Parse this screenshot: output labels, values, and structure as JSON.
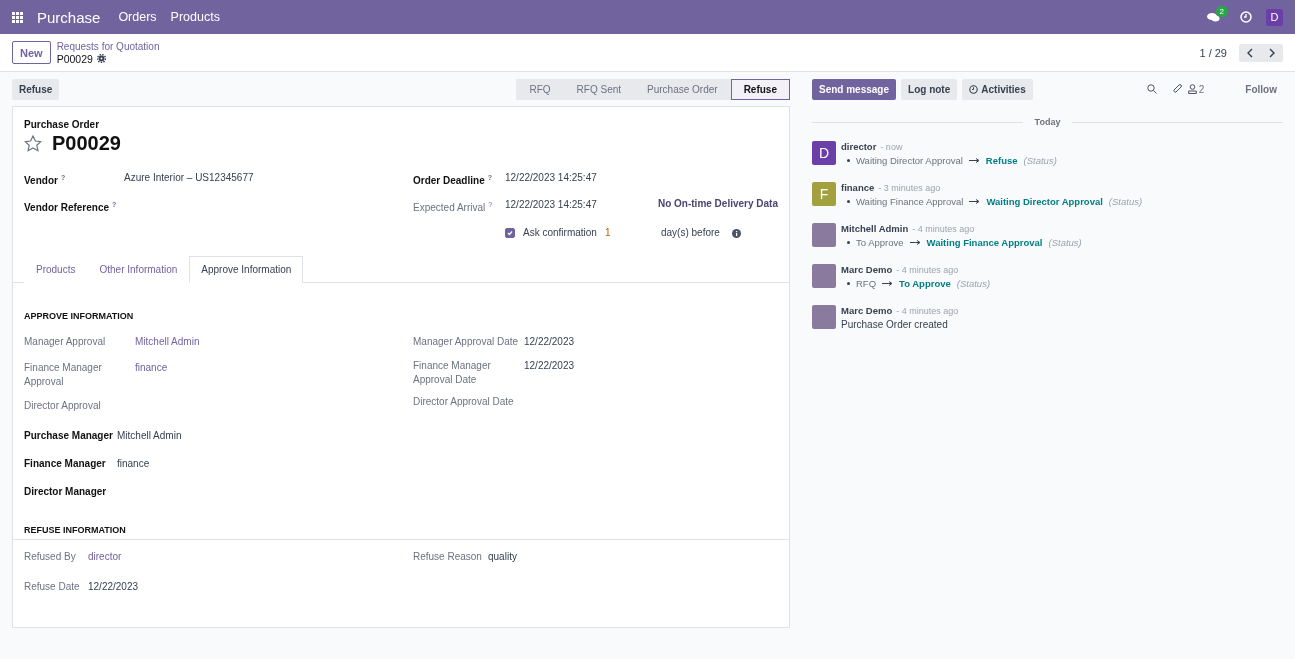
{
  "navbar": {
    "app_name": "Purchase",
    "menu": [
      {
        "label": "Orders"
      },
      {
        "label": "Products"
      }
    ],
    "messages_count": "2",
    "user_initial": "D"
  },
  "breadcrumb": {
    "new_button": "New",
    "parent": "Requests for Quotation",
    "current": "P00029",
    "pager": "1 / 29"
  },
  "action_buttons": [
    "Refuse"
  ],
  "statusbar": [
    {
      "label": "RFQ",
      "selected": false
    },
    {
      "label": "RFQ Sent",
      "selected": false
    },
    {
      "label": "Purchase Order",
      "selected": false
    },
    {
      "label": "Refuse",
      "selected": true
    }
  ],
  "form": {
    "title_label": "Purchase Order",
    "name": "P00029",
    "starred": false,
    "fields_left": [
      {
        "label": "Vendor",
        "help": "?",
        "kind": "strong",
        "value": "Azure Interior – US12345677"
      },
      {
        "label": "Vendor Reference",
        "help": "?",
        "kind": "strong"
      }
    ],
    "fields_right": [
      {
        "label": "Order Deadline",
        "help": "?",
        "kind": "strong",
        "value": "12/22/2023 14:25:47"
      },
      {
        "label": "Expected Arrival",
        "help": "?",
        "kind": "plain",
        "value": "12/22/2023 14:25:47",
        "extra": "No On-time Delivery Data"
      }
    ],
    "confirmation": {
      "checked": true,
      "label": "Ask confirmation",
      "value": "1",
      "suffix": "day(s) before"
    },
    "tabs": [
      {
        "label": "Products",
        "selected": false
      },
      {
        "label": "Other Information",
        "selected": false
      },
      {
        "label": "Approve Information",
        "selected": true
      }
    ],
    "approve": {
      "title": "APPROVE INFORMATION",
      "left": [
        {
          "label": "Manager Approval",
          "value": "Mitchell Admin",
          "link": true
        },
        {
          "label": "Finance Manager Approval",
          "value": "finance",
          "link": true
        },
        {
          "label": "Director Approval"
        }
      ],
      "right": [
        {
          "label": "Manager Approval Date",
          "value": "12/22/2023",
          "link": false
        },
        {
          "label": "Finance Manager Approval Date",
          "value": "12/22/2023",
          "link": false
        },
        {
          "label": "Director Approval Date"
        }
      ],
      "managers": [
        {
          "label": "Purchase Manager",
          "value": "Mitchell Admin"
        },
        {
          "label": "Finance Manager",
          "value": "finance"
        },
        {
          "label": "Director Manager"
        }
      ]
    },
    "refuse": {
      "title": "REFUSE INFORMATION",
      "left": [
        {
          "label": "Refused By",
          "value": "director",
          "link": true
        },
        {
          "label": "Refuse Date",
          "value": "12/22/2023",
          "link": false
        }
      ],
      "right": [
        {
          "label": "Refuse Reason",
          "value": "quality",
          "link": false
        }
      ]
    }
  },
  "chatter": {
    "buttons": [
      {
        "label": "Send message",
        "kind": "primary"
      },
      {
        "label": "Log note",
        "kind": "secondary"
      },
      {
        "label": "Activities",
        "kind": "activities"
      }
    ],
    "followers_count": "2",
    "follow": "Follow",
    "separator": "Today",
    "messages": [
      {
        "author": "director",
        "time": "- now",
        "kind": "letter",
        "initial": "D",
        "color": "#6b3fa8",
        "old": "Waiting Director Approval",
        "new": "Refuse",
        "field": "(Status)"
      },
      {
        "author": "finance",
        "time": "- 3 minutes ago",
        "kind": "letter",
        "initial": "F",
        "color": "#a3a13f",
        "old": "Waiting Finance Approval",
        "new": "Waiting Director Approval",
        "field": "(Status)"
      },
      {
        "author": "Mitchell Admin",
        "time": "- 4 minutes ago",
        "kind": "photo",
        "old": "To Approve",
        "new": "Waiting Finance Approval",
        "field": "(Status)"
      },
      {
        "author": "Marc Demo",
        "time": "- 4 minutes ago",
        "kind": "photo",
        "old": "RFQ",
        "new": "To Approve",
        "field": "(Status)"
      },
      {
        "author": "Marc Demo",
        "time": "- 4 minutes ago",
        "kind": "photo",
        "body": "Purchase Order created"
      }
    ]
  }
}
